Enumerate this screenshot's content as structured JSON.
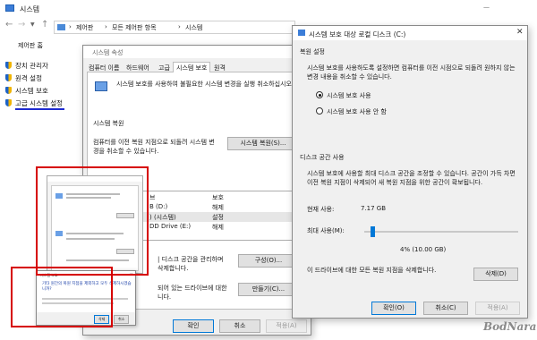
{
  "explorer": {
    "title": "시스템",
    "breadcrumb": [
      "제어판",
      "모든 제어판 항목",
      "시스템"
    ],
    "control_panel_home": "제어판 홈",
    "sidebar": [
      {
        "label": "장치 관리자"
      },
      {
        "label": "원격 설정"
      },
      {
        "label": "시스템 보호"
      },
      {
        "label": "고급 시스템 설정"
      }
    ]
  },
  "sysprops": {
    "title": "시스템 속성",
    "tabs": [
      "컴퓨터 이름",
      "하드웨어",
      "고급",
      "시스템 보호",
      "원격"
    ],
    "intro_text": "시스템 보호를 사용하여 불필요한 시스템 변경을 실행 취소하십시오.",
    "restore_header": "시스템 복원",
    "restore_text": "컴퓨터를 이전 복원 지점으로 되돌려 시스템 변경을 취소할 수 있습니다.",
    "restore_button": "시스템 복원(S)...",
    "drives_header_col": "보호",
    "drives_partial_col": "브",
    "drives": [
      {
        "name": "B (D:)",
        "status": "해제"
      },
      {
        "name": ") (시스템)",
        "status": "설정"
      },
      {
        "name": "DD Drive (E:)",
        "status": "해제"
      }
    ],
    "configure_text": "| 디스크 공간을 관리하며",
    "configure_text2": "삭제합니다.",
    "configure_button": "구성(O)...",
    "create_text": "되어 있는 드라이브에 대한",
    "create_text2": "니다.",
    "create_button": "만들기(C)...",
    "ok": "확인",
    "cancel": "취소",
    "apply": "적용(A)"
  },
  "protect": {
    "title": "시스템 보호 대상 로컬 디스크 (C:)",
    "restore_settings_header": "복원 설정",
    "restore_settings_text": "시스템 보호를 사용하도록 설정하면 컴퓨터를 이전 시점으로 되돌려 원하지 않는 변경 내용을 취소할 수 있습니다.",
    "radio_on": "시스템 보호 사용",
    "radio_off": "시스템 보호 사용 안 함",
    "selected": "on",
    "disk_usage_header": "디스크 공간 사용",
    "disk_usage_text": "시스템 보호에 사용할 최대 디스크 공간을 조정할 수 있습니다. 공간이 가득 차면 이전 복원 지점이 삭제되어 새 복원 지점을 위한 공간이 확보됩니다.",
    "current_usage_label": "현재 사용:",
    "current_usage_value": "7.17 GB",
    "max_usage_label": "최대 사용(M):",
    "slider_fraction": 0.04,
    "slider_readout": "4% (10.00 GB)",
    "delete_text": "이 드라이브에 대한 모든 복원 지점을 삭제합니다.",
    "delete_button": "삭제(D)",
    "ok": "확인(O)",
    "cancel": "취소(C)",
    "apply": "적용(A)"
  },
  "inset": {
    "dialog_title": "시스템 보호",
    "dialog_question": "기타 원간의 복원 지점을 제외하고 모두 삭제하시겠습니까?",
    "dialog_yes": "삭제",
    "dialog_no": "취소"
  },
  "watermark": "BodNara"
}
